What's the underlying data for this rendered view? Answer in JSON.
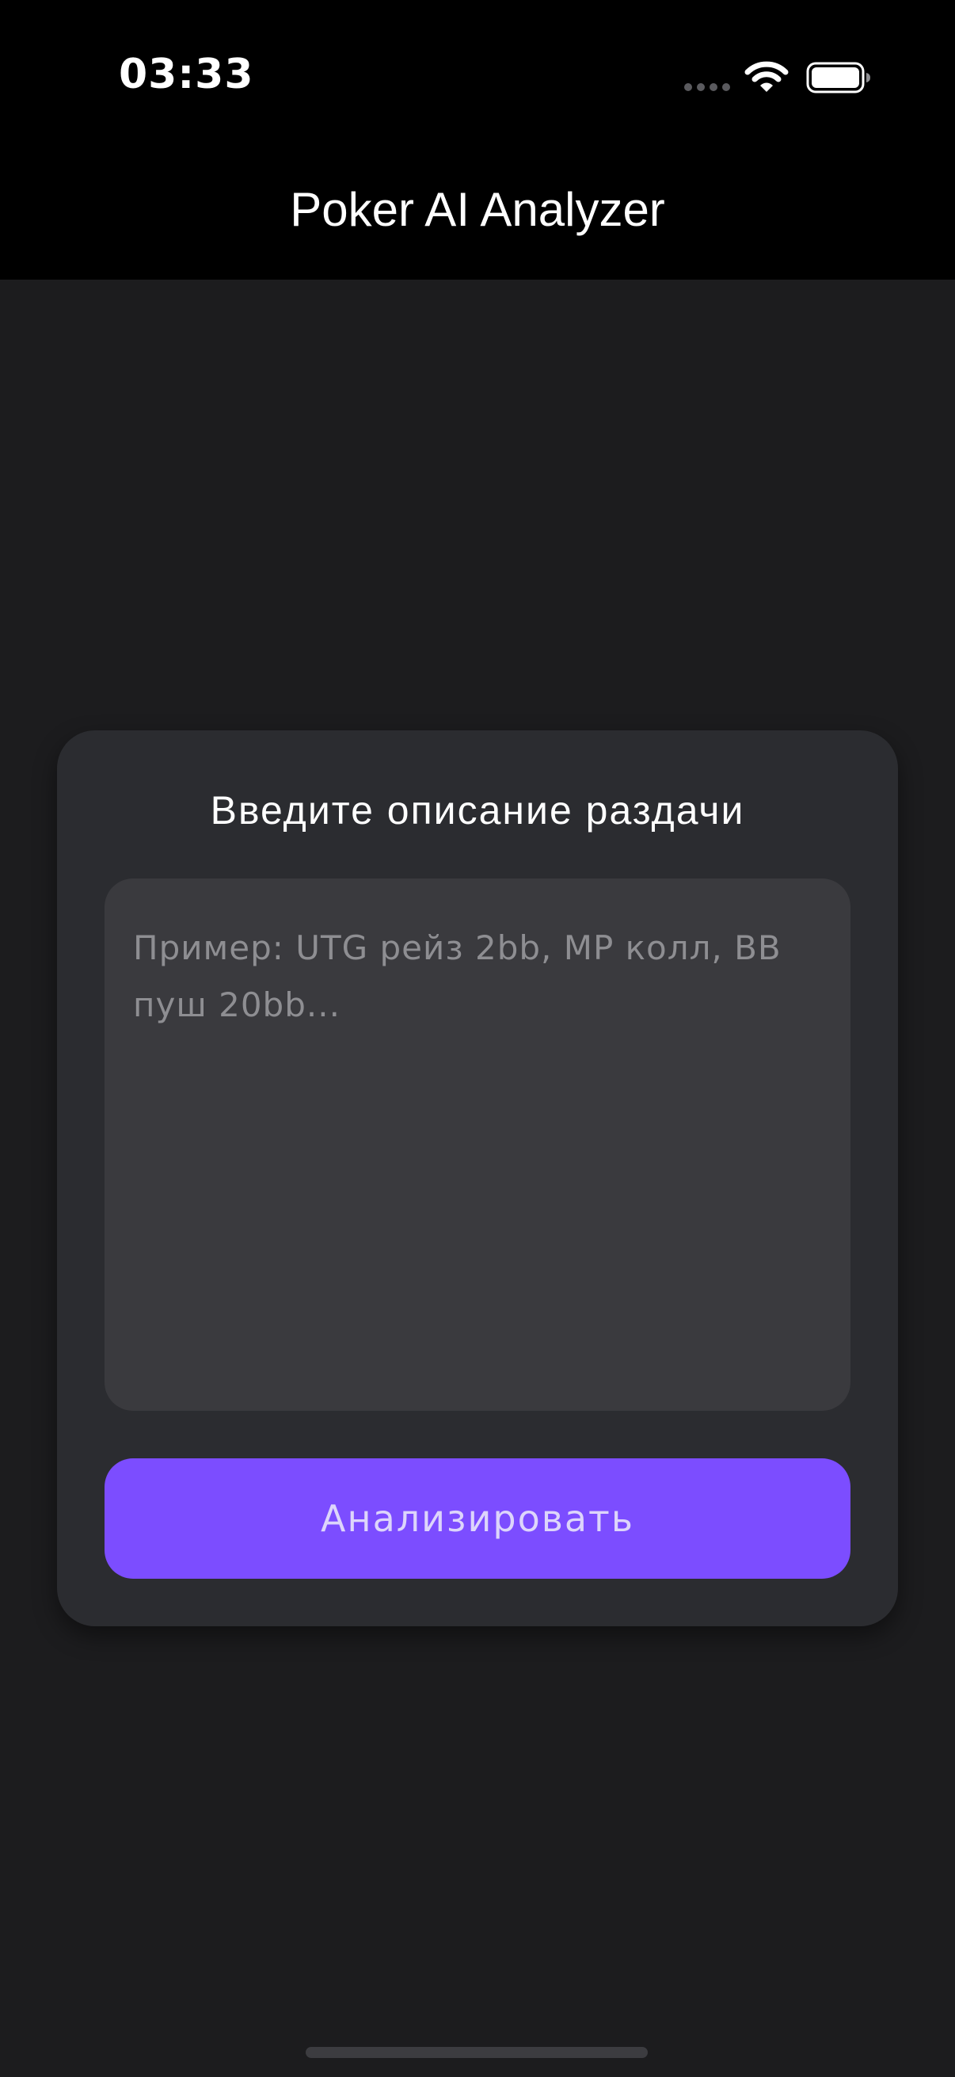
{
  "status_bar": {
    "time": "03:33",
    "icons": [
      "signal-dots-icon",
      "wifi-icon",
      "battery-icon"
    ]
  },
  "header": {
    "title": "Poker AI Analyzer"
  },
  "card": {
    "heading": "Введите описание раздачи",
    "input": {
      "value": "",
      "placeholder": "Пример: UTG рейз 2bb, MP колл, BB пуш 20bb..."
    },
    "analyze_button_label": "Анализировать"
  },
  "colors": {
    "background": "#1c1c1e",
    "header": "#000000",
    "card": "#2b2c30",
    "input": "#3a3a3e",
    "accent": "#7c4dff"
  }
}
